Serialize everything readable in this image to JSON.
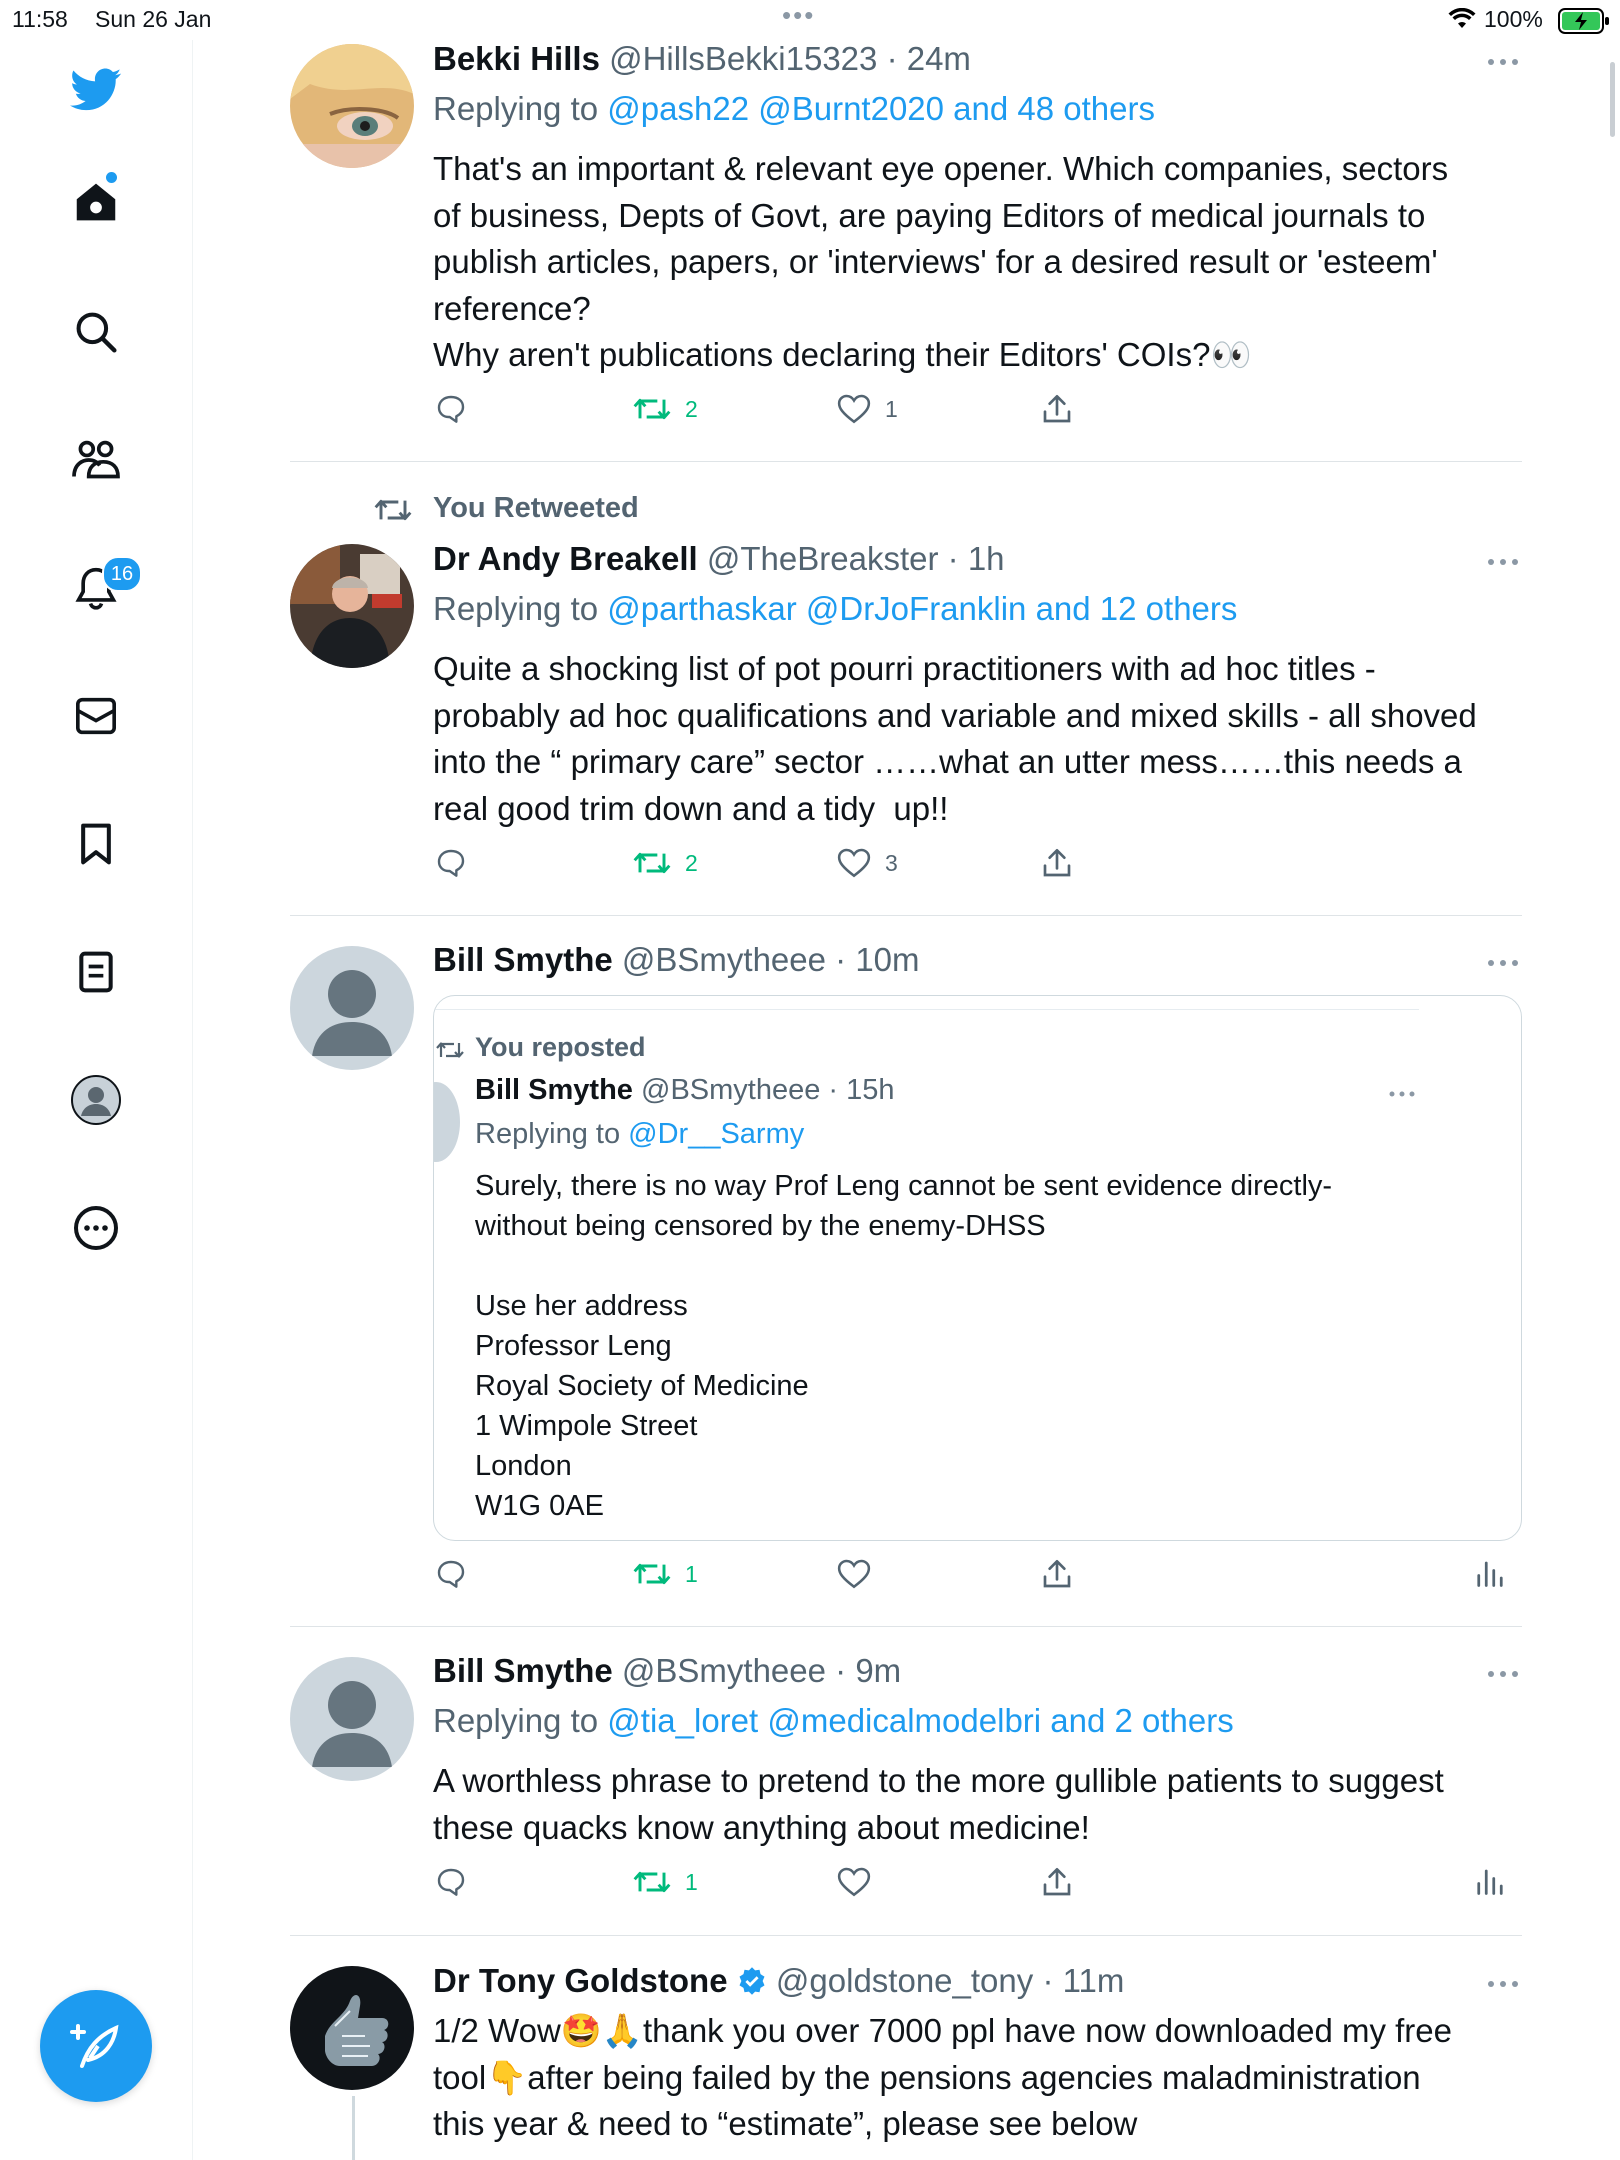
{
  "status_bar": {
    "time": "11:58",
    "date": "Sun 26 Jan",
    "battery": "100%"
  },
  "sidebar": {
    "notifications_badge": "16"
  },
  "tweets": [
    {
      "name": "Bekki Hills",
      "handle": "@HillsBekki15323",
      "time": "· 24m",
      "replying_prefix": "Replying to",
      "replying_links": "@pash22 @Burnt2020 and 48 others",
      "body": "That's an important & relevant eye opener. Which companies, sectors\nof business, Depts of Govt, are paying Editors of medical journals to\npublish articles, papers, or 'interviews' for a desired result or 'esteem'\nreference?\nWhy aren't publications declaring their Editors' COIs?👀",
      "retweets": "2",
      "likes": "1"
    },
    {
      "retweeted_label": "You Retweeted",
      "name": "Dr Andy Breakell",
      "handle": "@TheBreakster",
      "time": "· 1h",
      "replying_prefix": "Replying to",
      "replying_links": "@parthaskar @DrJoFranklin and 12 others",
      "body": "Quite a shocking list of pot pourri practitioners with ad hoc titles -\nprobably ad hoc qualifications and variable and mixed skills - all shoved\ninto the “ primary care” sector ……what an utter mess……this needs a\nreal good trim down and a tidy  up!!",
      "retweets": "2",
      "likes": "3"
    },
    {
      "name": "Bill Smythe",
      "handle": "@BSmytheee",
      "time": "· 10m",
      "quote": {
        "reposted_label": "You reposted",
        "name": "Bill Smythe",
        "handle": "@BSmytheee",
        "time": "· 15h",
        "replying_prefix": "Replying to",
        "replying_links": "@Dr__Sarmy",
        "body": "Surely, there is no way Prof Leng cannot be sent evidence directly-\nwithout being censored by the enemy-DHSS\n\nUse her address\nProfessor Leng\nRoyal Society of Medicine\n1 Wimpole Street\nLondon\nW1G 0AE"
      },
      "retweets": "1",
      "likes": ""
    },
    {
      "name": "Bill Smythe",
      "handle": "@BSmytheee",
      "time": "· 9m",
      "replying_prefix": "Replying to",
      "replying_links": "@tia_loret @medicalmodelbri and 2 others",
      "body": "A worthless phrase to pretend to the more gullible patients to suggest\nthese quacks know anything about medicine!",
      "retweets": "1",
      "likes": ""
    },
    {
      "name": "Dr Tony Goldstone",
      "handle": "@goldstone_tony",
      "time": "· 11m",
      "body": "1/2 Wow🤩🙏thank you over 7000 ppl have now downloaded my free\ntool👇after being failed by the pensions agencies maladministration\nthis year & need to “estimate”, please see below"
    }
  ]
}
